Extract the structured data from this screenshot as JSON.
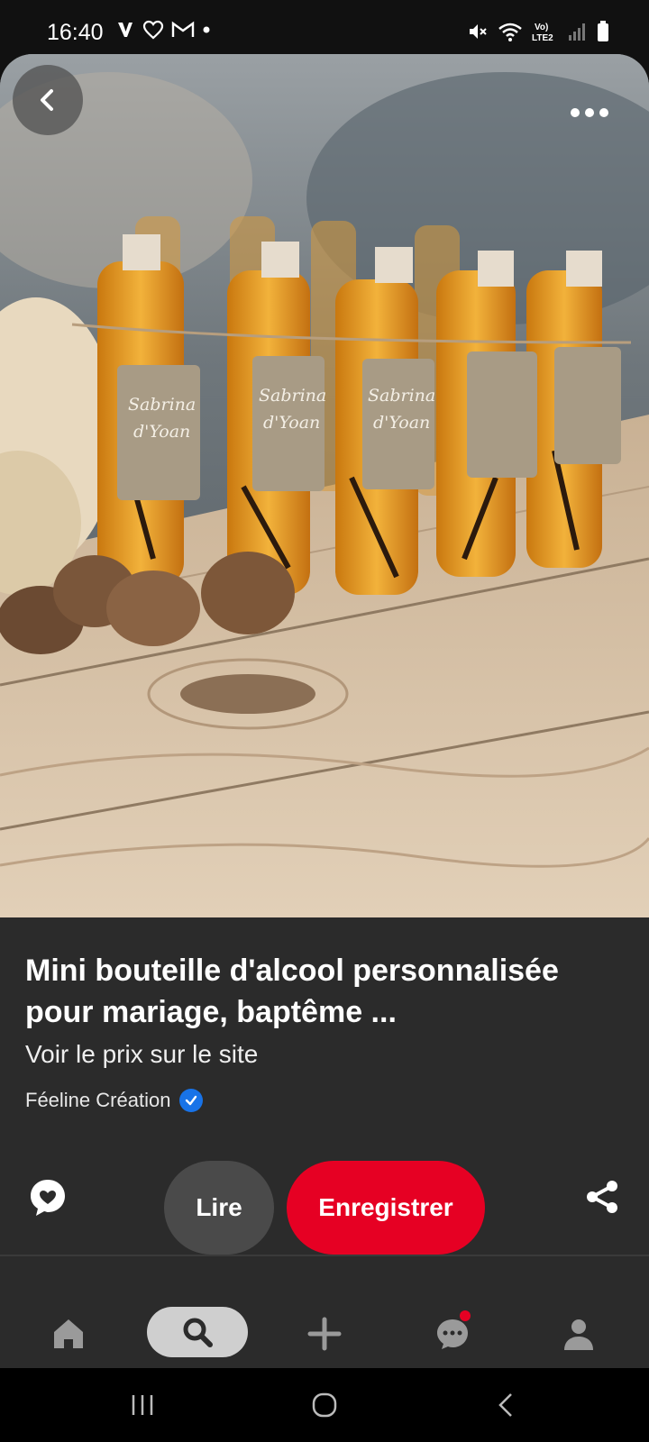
{
  "status_bar": {
    "time": "16:40",
    "left_icons": [
      "v-app-icon",
      "heart-outline-icon",
      "gmail-icon",
      "dot-icon"
    ],
    "right_icons": [
      "mute-icon",
      "wifi-icon",
      "volte-icon",
      "signal-icon",
      "battery-icon"
    ],
    "volte_label": "Vo)\nLTE2"
  },
  "image": {
    "back_icon": "chevron-left-icon",
    "more_icon": "more-dots-icon",
    "tag_text_line1": "Sabrina",
    "tag_text_line2": "d'Yoan"
  },
  "pin": {
    "title": "Mini bouteille d'alcool personnalisée pour mariage, baptême ...",
    "price_link": "Voir le prix sur le site",
    "creator": "Féeline Création",
    "verified_icon": "verified-badge-icon"
  },
  "actions": {
    "comment_icon": "comment-heart-icon",
    "read_label": "Lire",
    "save_label": "Enregistrer",
    "share_icon": "share-icon"
  },
  "nav": {
    "items": [
      {
        "name": "home",
        "icon": "home-icon"
      },
      {
        "name": "search",
        "icon": "search-icon",
        "active": true
      },
      {
        "name": "create",
        "icon": "plus-icon"
      },
      {
        "name": "messages",
        "icon": "chat-icon",
        "has_notification": true
      },
      {
        "name": "profile",
        "icon": "profile-icon"
      }
    ]
  },
  "colors": {
    "save_red": "#e60023",
    "panel_bg": "#2b2b2b",
    "verified_blue": "#1873e8"
  }
}
